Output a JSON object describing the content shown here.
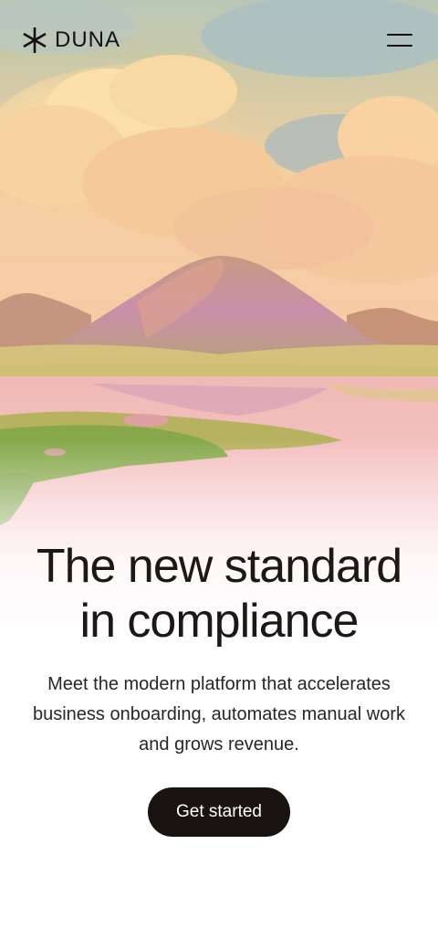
{
  "header": {
    "brand_name": "DUNA",
    "logo_icon": "asterisk-logo-icon",
    "menu_icon": "hamburger-menu-icon"
  },
  "hero": {
    "image": "landscape-painting-mountains-lake",
    "headline_line1": "The new standard",
    "headline_line2": "in compliance",
    "subtext": "Meet the modern platform that accelerates business onboarding, automates manual work and grows revenue.",
    "cta_label": "Get started"
  },
  "colors": {
    "text": "#1b1816",
    "cta_background": "#1a1411",
    "cta_text": "#ffffff",
    "background": "#ffffff"
  }
}
